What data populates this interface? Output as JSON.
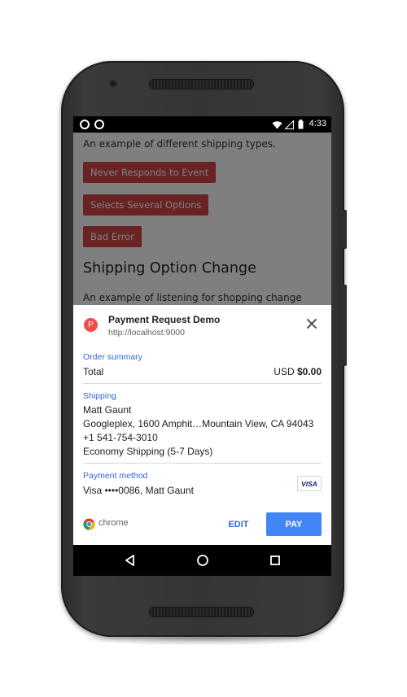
{
  "status_bar": {
    "time": "4:33"
  },
  "webpage": {
    "intro_text": "An example of different shipping types.",
    "buttons": [
      {
        "label": "Never Responds to Event"
      },
      {
        "label": "Selects Several Options"
      },
      {
        "label": "Bad Error"
      }
    ],
    "heading": "Shipping Option Change",
    "description": "An example of listening for shopping change"
  },
  "payment_sheet": {
    "merchant": {
      "icon_letter": "P",
      "title": "Payment Request Demo",
      "url": "http://localhost:9000"
    },
    "order_summary": {
      "label": "Order summary",
      "total_label": "Total",
      "currency": "USD",
      "amount": "$0.00"
    },
    "shipping": {
      "label": "Shipping",
      "name": "Matt Gaunt",
      "address": "Googleplex, 1600 Amphit…Mountain View, CA 94043",
      "phone": "+1 541-754-3010",
      "option": "Economy Shipping (5-7 Days)"
    },
    "payment_method": {
      "label": "Payment method",
      "card": "Visa  ••••0086, Matt Gaunt",
      "badge": "VISA"
    },
    "footer": {
      "brand": "chrome",
      "edit_label": "EDIT",
      "pay_label": "PAY"
    }
  },
  "colors": {
    "demo_button": "#d24747",
    "link_blue": "#3367d6",
    "pay_button": "#4285f4",
    "merchant_icon": "#f04a4a"
  },
  "icons": [
    "merchant-icon",
    "close-icon",
    "visa-icon",
    "chrome-icon",
    "back-icon",
    "home-icon",
    "recents-icon",
    "wifi-icon",
    "signal-icon",
    "battery-icon"
  ]
}
